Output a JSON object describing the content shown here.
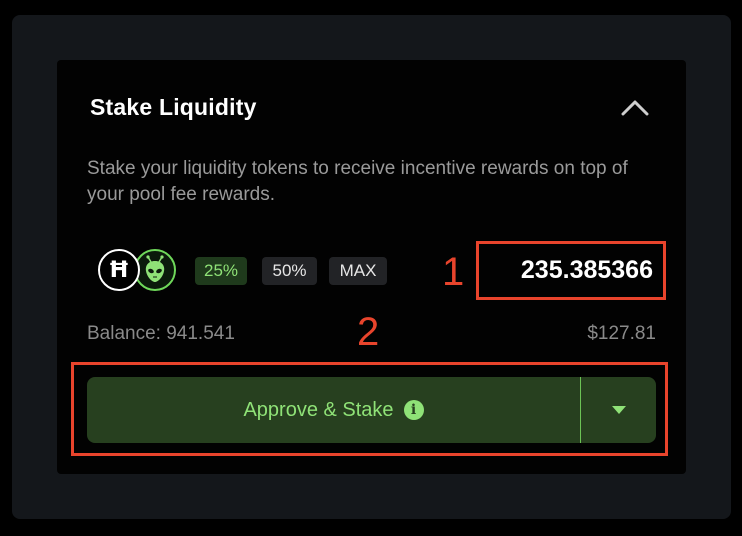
{
  "card": {
    "title": "Stake Liquidity",
    "description": "Stake your liquidity tokens to receive incentive rewards on top of your pool fee rewards."
  },
  "tokens": [
    {
      "icon": "hbar-icon",
      "symbol": "Ħ"
    },
    {
      "icon": "alien-icon"
    }
  ],
  "percent_buttons": {
    "p25": "25%",
    "p50": "50%",
    "max": "MAX",
    "selected": "25%"
  },
  "amount": {
    "value": "235.385366"
  },
  "balance": {
    "text": "Balance: 941.541",
    "usd": "$127.81"
  },
  "action": {
    "label": "Approve & Stake",
    "info_icon": "i"
  },
  "annotations": {
    "marker_1": "1",
    "marker_2": "2"
  },
  "colors": {
    "accent_green": "#8fe277",
    "button_bg": "#27401f",
    "annotation_red": "#e8442c",
    "card_bg": "#020202",
    "frame_bg": "#14171b"
  }
}
